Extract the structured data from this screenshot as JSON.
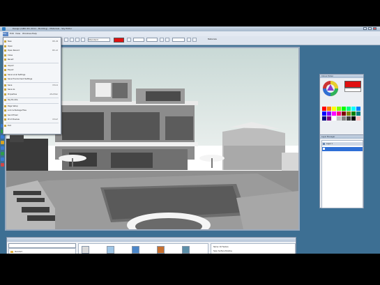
{
  "app": {
    "title": "Design (GMO Pro 2011 - Building) - Materials - Sky Editor",
    "panel_right_title": "Materials"
  },
  "menubar": {
    "items": [
      "File",
      "Edit",
      "View",
      "Windows",
      "Help"
    ]
  },
  "toolbar": {
    "combo_1": "Standard",
    "accent_color": "#e01010"
  },
  "file_menu": {
    "items": [
      {
        "label": "New",
        "shortcut": "Ctrl+N"
      },
      {
        "label": "Open",
        "shortcut": ""
      },
      {
        "label": "Open Recent",
        "shortcut": "Ctrl+O"
      },
      {
        "label": "Close",
        "shortcut": ""
      },
      {
        "label": "Revert",
        "shortcut": ""
      },
      {
        "label": "Import",
        "shortcut": ""
      },
      {
        "label": "Export",
        "shortcut": ""
      },
      {
        "label": "Save Local Settings",
        "shortcut": ""
      },
      {
        "label": "Save Environment Settings",
        "shortcut": ""
      },
      {
        "label": "Save",
        "shortcut": "Ctrl+S"
      },
      {
        "label": "Save As",
        "shortcut": ""
      },
      {
        "label": "Properties",
        "shortcut": "Alt+Enter"
      },
      {
        "label": "Sky Bundle",
        "shortcut": ""
      },
      {
        "label": "Page Setup",
        "shortcut": ""
      },
      {
        "label": "Lock & Package Files",
        "shortcut": ""
      },
      {
        "label": "Send Email",
        "shortcut": ""
      },
      {
        "label": "Print Preview",
        "shortcut": "Ctrl+P"
      },
      {
        "label": "Exit",
        "shortcut": ""
      }
    ]
  },
  "color_panel": {
    "title": "Colour Picker"
  },
  "layer_panel": {
    "title": "Layer Manager",
    "selected_layer": "Layer 1"
  },
  "material_panel": {
    "folders": [
      "Standard",
      "Architecture",
      "Imported",
      "Templates",
      "Materials",
      "Objects"
    ],
    "thumb_labels": [
      "Wall-Grey",
      "Glass",
      "Tile-Blue",
      "Wood-01",
      "Water",
      "Metal-Lt",
      "Stone",
      "Ground",
      "Black-Slate"
    ],
    "props": [
      "Name: Oil Feature",
      "Type: Surface Shading"
    ]
  }
}
